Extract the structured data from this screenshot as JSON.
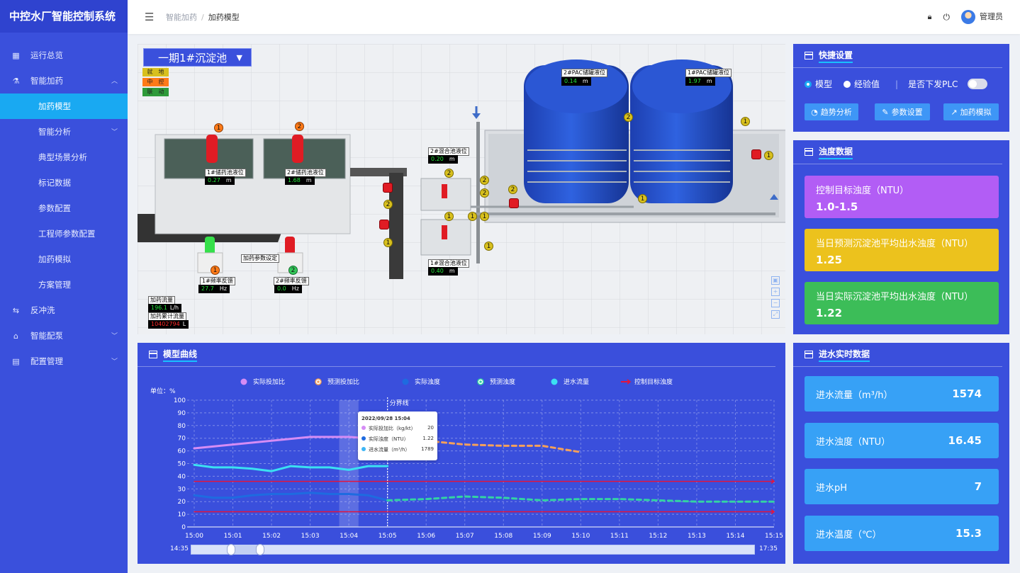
{
  "app_title": "中控水厂智能控制系统",
  "sidebar": {
    "items": [
      {
        "label": "运行总览",
        "icon": "overview-icon"
      },
      {
        "label": "智能加药",
        "icon": "dosing-icon",
        "expanded": true
      },
      {
        "label": "加药模型",
        "active": true
      },
      {
        "label": "智能分析",
        "has_children": true
      },
      {
        "label": "典型场景分析"
      },
      {
        "label": "标记数据"
      },
      {
        "label": "参数配置"
      },
      {
        "label": "工程师参数配置"
      },
      {
        "label": "加药模拟"
      },
      {
        "label": "方案管理"
      },
      {
        "label": "反冲洗",
        "icon": "backwash-icon"
      },
      {
        "label": "智能配泵",
        "icon": "pump-icon",
        "has_children": true
      },
      {
        "label": "配置管理",
        "icon": "config-icon",
        "has_children": true
      }
    ]
  },
  "header": {
    "breadcrumb": [
      "智能加药",
      "加药模型"
    ],
    "user": "管理员"
  },
  "scene": {
    "selector": "一期1#沉淀池",
    "modes": [
      "就　地",
      "中　控",
      "联　动"
    ],
    "mode_colors": [
      "#d8c01e",
      "#ff7a18",
      "#2e9a3a"
    ],
    "tank1_label": "1#储药池液位",
    "tank1_value": "0.27",
    "tank1_unit": "m",
    "tank2_label": "2#储药池液位",
    "tank2_value": "1.68",
    "tank2_unit": "m",
    "mix2_label": "2#混合池液位",
    "mix2_value": "0.20",
    "mix2_unit": "m",
    "mix1_label": "1#混合池液位",
    "mix1_value": "0.40",
    "mix1_unit": "m",
    "pac2_label": "2#PAC储罐液位",
    "pac2_value": "0.14",
    "pac2_unit": "m",
    "pac1_label": "1#PAC储罐液位",
    "pac1_value": "1.97",
    "pac1_unit": "m",
    "dose_param": "加药参数设定",
    "freq1_label": "1#频率反馈",
    "freq1_value": "27.7",
    "freq1_unit": "Hz",
    "freq2_label": "2#频率反馈",
    "freq2_value": "0.0",
    "freq2_unit": "Hz",
    "flow_label": "加药流量",
    "flow_value": "196.1",
    "flow_unit": "L/h",
    "total_label": "加药累计流量",
    "total_value": "10402794",
    "total_unit": "L"
  },
  "quick": {
    "title": "快捷设置",
    "radio_model": "模型",
    "radio_exp": "经验值",
    "plc_label": "是否下发PLC",
    "btn_trend": "趋势分析",
    "btn_param": "参数设置",
    "btn_sim": "加药模拟"
  },
  "turbidity": {
    "title": "浊度数据",
    "items": [
      {
        "label": "控制目标浊度（NTU）",
        "value": "1.0-1.5",
        "color": "#b25df5"
      },
      {
        "label": "当日预测沉淀池平均出水浊度（NTU）",
        "value": "1.25",
        "color": "#ecc21d"
      },
      {
        "label": "当日实际沉淀池平均出水浊度（NTU）",
        "value": "1.22",
        "color": "#3cbd58"
      }
    ]
  },
  "realtime": {
    "title": "进水实时数据",
    "items": [
      {
        "label": "进水流量（m³/h）",
        "value": "1574"
      },
      {
        "label": "进水浊度（NTU）",
        "value": "16.45"
      },
      {
        "label": "进水pH",
        "value": "7"
      },
      {
        "label": "进水温度（℃）",
        "value": "15.3"
      }
    ]
  },
  "curve": {
    "title": "模型曲线",
    "slider_start": "14:35",
    "slider_end": "17:35",
    "tooltip": {
      "time": "2022/09/28 15:04",
      "rows": [
        {
          "label": "实际投加比（kg/kt）",
          "value": "20",
          "color": "#d58cf5"
        },
        {
          "label": "实际浊度（NTU）",
          "value": "1.22",
          "color": "#1e6be0"
        },
        {
          "label": "进水流量（m³/h）",
          "value": "1789",
          "color": "#3eb6f5"
        }
      ]
    }
  },
  "chart_data": {
    "type": "line",
    "ylabel": "单位：%",
    "ylim": [
      0,
      100
    ],
    "yticks": [
      0,
      10,
      20,
      30,
      40,
      50,
      60,
      70,
      80,
      90,
      100
    ],
    "categories": [
      "15:00",
      "15:01",
      "15:02",
      "15:03",
      "15:04",
      "15:05",
      "15:06",
      "15:07",
      "15:08",
      "15:09",
      "15:10",
      "15:11",
      "15:12",
      "15:13",
      "15:14",
      "15:15"
    ],
    "divider_label": "分界线",
    "divider_x": 5,
    "series": [
      {
        "name": "实际投加比",
        "color": "#d58cf5",
        "style": "solid",
        "x": [
          0,
          1,
          2,
          3,
          4,
          5
        ],
        "values": [
          62,
          65,
          68,
          71,
          71,
          69
        ]
      },
      {
        "name": "预测投加比",
        "color": "#f5a05a",
        "style": "dashed",
        "x": [
          5,
          6,
          7,
          8,
          9,
          10
        ],
        "values": [
          69,
          68,
          65,
          64,
          64,
          59
        ]
      },
      {
        "name": "实际浊度",
        "color": "#1e6be0",
        "style": "solid",
        "x": [
          0,
          0.5,
          1,
          1.5,
          2,
          2.5,
          3,
          3.5,
          4,
          4.5,
          5
        ],
        "values": [
          25,
          23,
          23,
          25,
          26,
          26,
          27,
          26,
          26,
          25,
          21
        ]
      },
      {
        "name": "预测浊度",
        "color": "#33d3a3",
        "style": "dashed",
        "x": [
          5,
          6,
          7,
          8,
          9,
          10,
          11,
          12,
          13,
          14,
          15
        ],
        "values": [
          21,
          22,
          24,
          23,
          21,
          22,
          22,
          21,
          20,
          20,
          20
        ]
      },
      {
        "name": "进水流量",
        "color": "#3be0f2",
        "style": "solid",
        "x": [
          0,
          0.5,
          1,
          1.5,
          2,
          2.5,
          3,
          3.5,
          4,
          4.5,
          5
        ],
        "values": [
          49,
          47,
          47,
          46,
          44,
          48,
          47,
          47,
          45,
          48,
          48
        ]
      },
      {
        "name": "控制目标浊度",
        "color": "#e4143c",
        "style": "solid",
        "x": [
          0,
          15
        ],
        "values": [
          36,
          36
        ]
      },
      {
        "name": "控制目标浊度-下限",
        "color": "#e4143c",
        "style": "solid",
        "x": [
          0,
          15
        ],
        "values": [
          12,
          12
        ]
      }
    ],
    "legend": [
      "实际投加比",
      "预测投加比",
      "实际浊度",
      "预测浊度",
      "进水流量",
      "控制目标浊度"
    ]
  }
}
